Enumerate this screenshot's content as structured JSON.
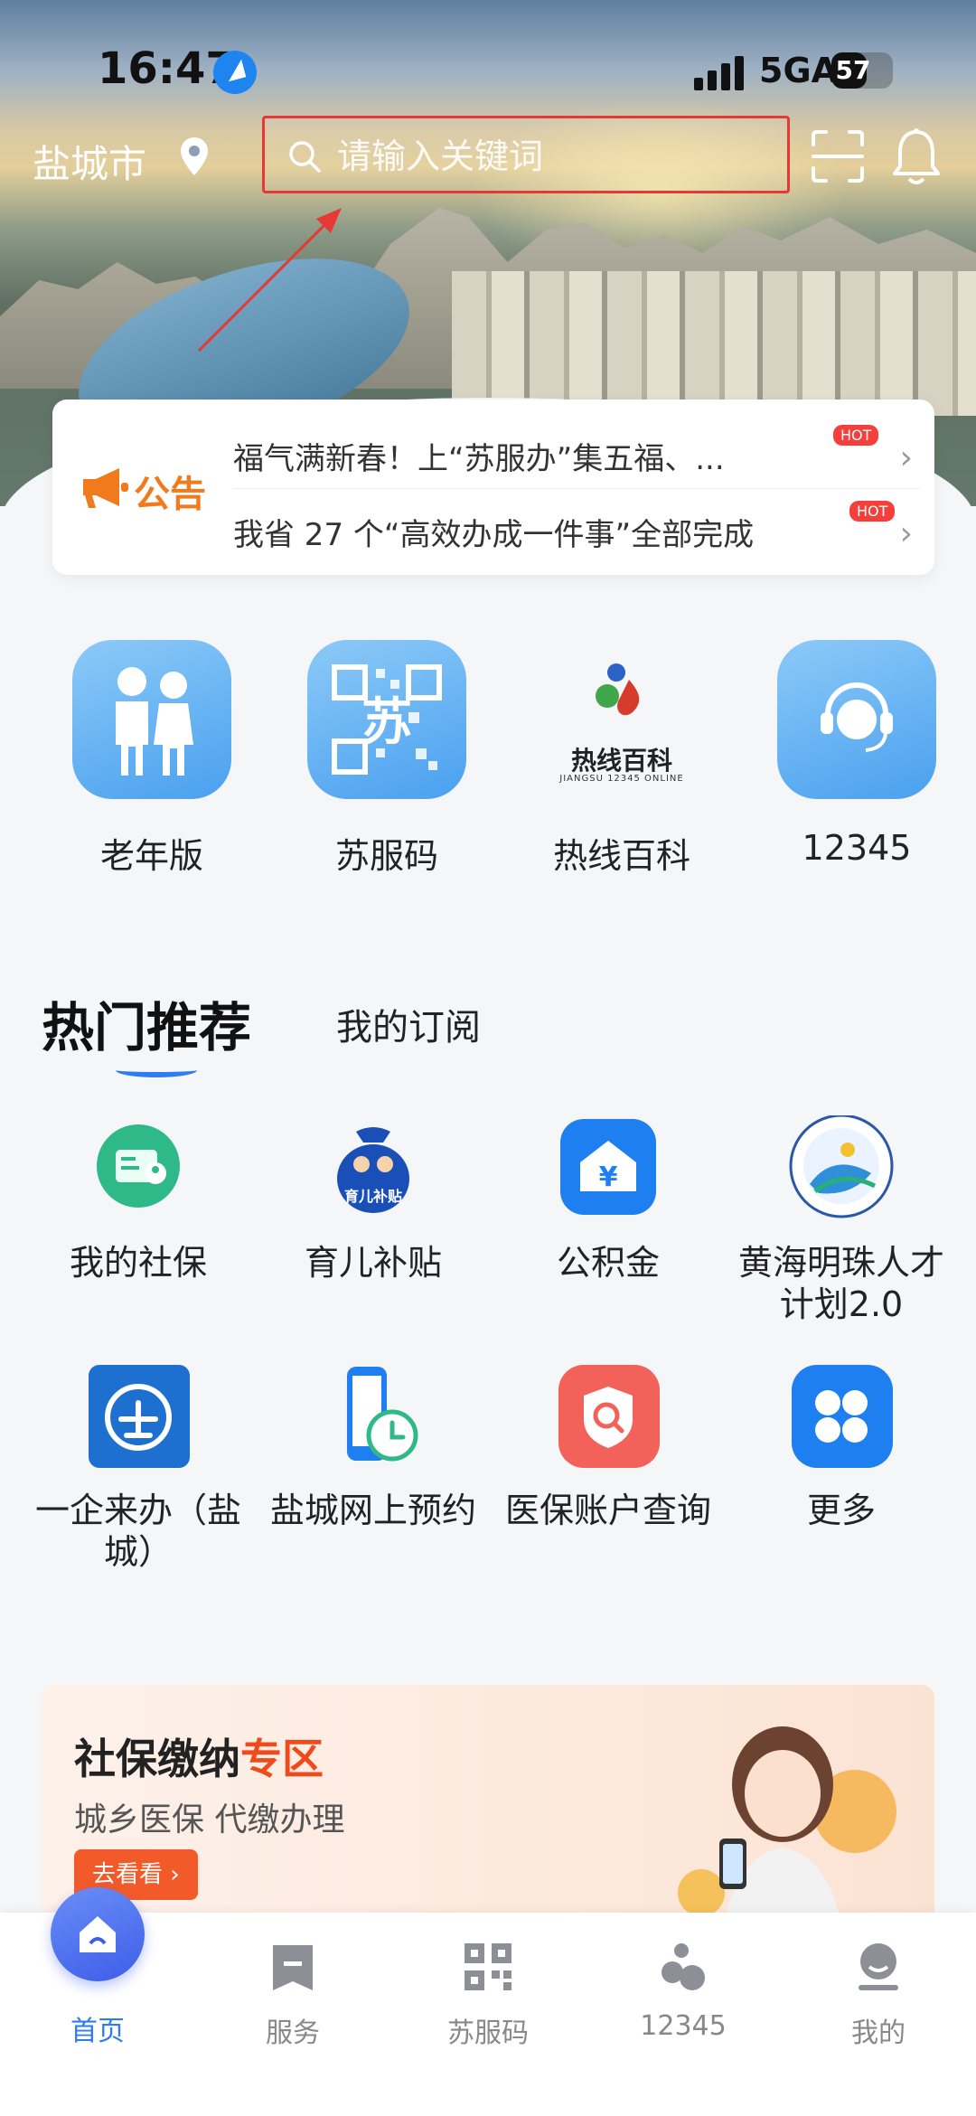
{
  "status_bar": {
    "time": "16:47",
    "network": "5GA",
    "battery": "57",
    "battery_level": 0.57
  },
  "header": {
    "city": "盐城市",
    "search_placeholder": "请输入关键词"
  },
  "notice": {
    "label": "公告",
    "items": [
      {
        "text": "福气满新春！上“苏服办”集五福、...",
        "badge": "HOT"
      },
      {
        "text": "我省 27 个“高效办成一件事”全部完成",
        "badge": "HOT"
      }
    ]
  },
  "quick_actions": [
    {
      "label": "老年版",
      "icon": "elderly-couple-icon"
    },
    {
      "label": "苏服码",
      "icon": "qr-code-icon"
    },
    {
      "label": "热线百科",
      "icon": "hotline-encyclopedia-logo",
      "logo_text": "热线百科",
      "logo_sub": "JIANGSU 12345 ONLINE"
    },
    {
      "label": "12345",
      "icon": "headset-agent-icon"
    }
  ],
  "tabs": {
    "hot": "热门推荐",
    "subscribed": "我的订阅"
  },
  "services": [
    {
      "label": "我的社保",
      "icon": "social-security-card-icon"
    },
    {
      "label": "育儿补贴",
      "icon": "childcare-subsidy-icon",
      "icon_text": "育儿补贴"
    },
    {
      "label": "公积金",
      "icon": "housing-fund-icon"
    },
    {
      "label": "黄海明珠人才计划2.0",
      "icon": "yellow-sea-pearl-logo"
    },
    {
      "label": "一企来办（盐城）",
      "icon": "one-enterprise-icon"
    },
    {
      "label": "盐城网上预约",
      "icon": "phone-clock-icon"
    },
    {
      "label": "医保账户查询",
      "icon": "medical-insurance-search-icon"
    },
    {
      "label": "更多",
      "icon": "more-grid-icon"
    }
  ],
  "banner": {
    "title_a": "社保缴纳",
    "title_b": "专区",
    "subtitle": "城乡医保 代缴办理",
    "button": "去看看 ›"
  },
  "bottom_nav": [
    {
      "label": "首页",
      "icon": "home-icon",
      "active": true
    },
    {
      "label": "服务",
      "icon": "bookmark-icon",
      "active": false
    },
    {
      "label": "苏服码",
      "icon": "qr-code-icon",
      "active": false
    },
    {
      "label": "12345",
      "icon": "hotline-icon",
      "active": false
    },
    {
      "label": "我的",
      "icon": "profile-icon",
      "active": false
    }
  ],
  "colors": {
    "accent": "#2f7bf2",
    "annotation": "#e53935",
    "notice": "#f07a1c"
  }
}
